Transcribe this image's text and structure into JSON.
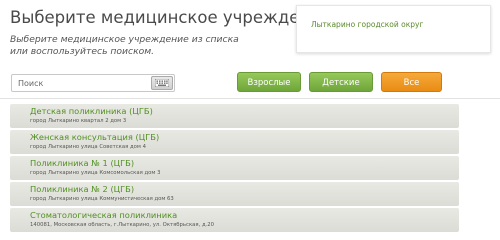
{
  "page": {
    "title": "Выберите медицинское учреждение",
    "subtitle": "Выберите медицинское учреждение из списка или воспользуйтесь поиском."
  },
  "region": {
    "selected": "Лыткарино городской округ"
  },
  "search": {
    "placeholder": "Поиск",
    "value": "",
    "keyboard_icon": "keyboard-icon"
  },
  "filters": [
    {
      "label": "Взрослые",
      "color": "#7fb646",
      "active": false
    },
    {
      "label": "Детские",
      "color": "#7fb646",
      "active": false
    },
    {
      "label": "Все",
      "color": "#f09a1f",
      "active": true
    }
  ],
  "facilities": [
    {
      "name": "Детская поликлиника (ЦГБ)",
      "address": "город Лыткарино квартал 2 дом 3"
    },
    {
      "name": "Женская консультация (ЦГБ)",
      "address": "город Лыткарино улица Советская дом 4"
    },
    {
      "name": "Поликлиника № 1 (ЦГБ)",
      "address": "город Лыткарино улица Комсомольская дом 3"
    },
    {
      "name": "Поликлиника № 2 (ЦГБ)",
      "address": "город Лыткарино улица Коммунистическая дом 63"
    },
    {
      "name": "Стоматологическая поликлиника",
      "address": "140081, Московская область, г.Лыткарино, ул. Октябрьская, д.20"
    }
  ],
  "colors": {
    "accent_green": "#4f8f1f",
    "accent_orange": "#f09a1f",
    "row_background": "#e2e2dc"
  }
}
